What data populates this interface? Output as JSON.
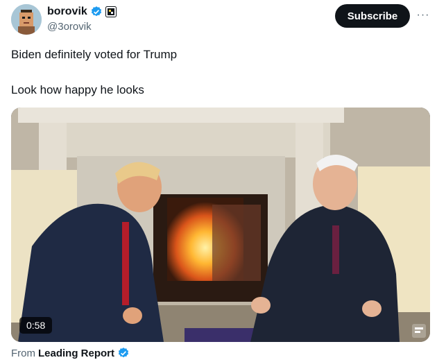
{
  "author": {
    "display_name": "borovik",
    "handle": "@3orovik",
    "verified_icon": "verified-badge-icon",
    "label_icon": "affiliate-label-icon"
  },
  "header": {
    "subscribe_label": "Subscribe",
    "more_label": "···"
  },
  "tweet": {
    "line1": "Biden definitely voted for Trump",
    "line2": "Look how happy he looks"
  },
  "media": {
    "duration": "0:58"
  },
  "source": {
    "prefix": "From",
    "name": "Leading Report"
  },
  "colors": {
    "text": "#0f1419",
    "secondary": "#536471",
    "verified": "#1d9bf0",
    "subscribe_bg": "#0f1419"
  }
}
